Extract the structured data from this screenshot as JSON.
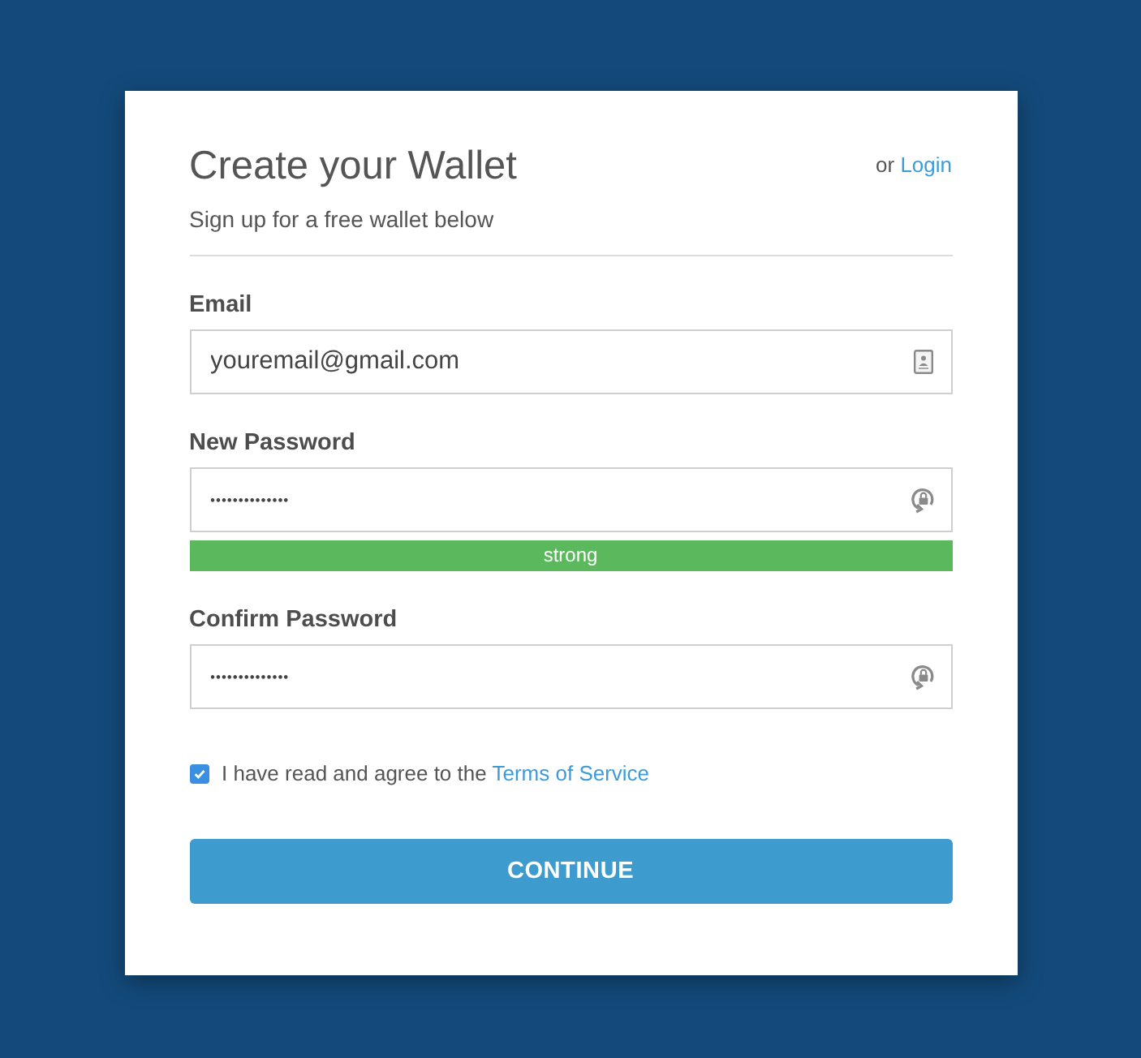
{
  "header": {
    "title": "Create your Wallet",
    "login_prompt": "or",
    "login_link": "Login",
    "subtitle": "Sign up for a free wallet below"
  },
  "fields": [
    {
      "kind": "email",
      "label": "Email",
      "value": "youremail@gmail.com"
    },
    {
      "kind": "password",
      "label": "New Password",
      "value": "••••••••••••••",
      "strength": {
        "level": 1,
        "label": "strong"
      }
    },
    {
      "kind": "password",
      "label": "Confirm Password",
      "value": "••••••••••••••"
    }
  ],
  "agreement": {
    "checked": true,
    "text": "I have read and agree to the",
    "link": "Terms of Service"
  },
  "submit": {
    "label": "CONTINUE"
  }
}
